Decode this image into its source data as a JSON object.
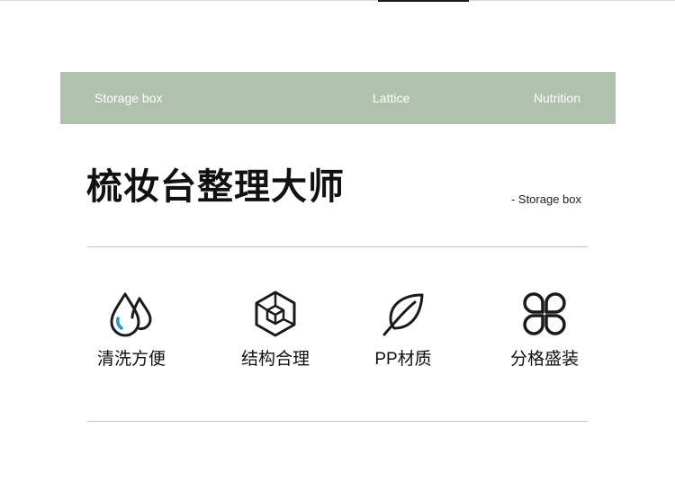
{
  "banner": {
    "left": "Storage box",
    "center": "Lattice",
    "right": "Nutrition",
    "color": "#b0c2ad"
  },
  "title": "梳妆台整理大师",
  "subtitle": "- Storage box",
  "features": [
    {
      "label": "清洗方便",
      "icon": "water-drops-icon"
    },
    {
      "label": "结构合理",
      "icon": "cube-structure-icon"
    },
    {
      "label": "PP材质",
      "icon": "leaf-icon"
    },
    {
      "label": "分格盛装",
      "icon": "four-petal-grid-icon"
    }
  ],
  "accent_color": "#1e9bd7"
}
